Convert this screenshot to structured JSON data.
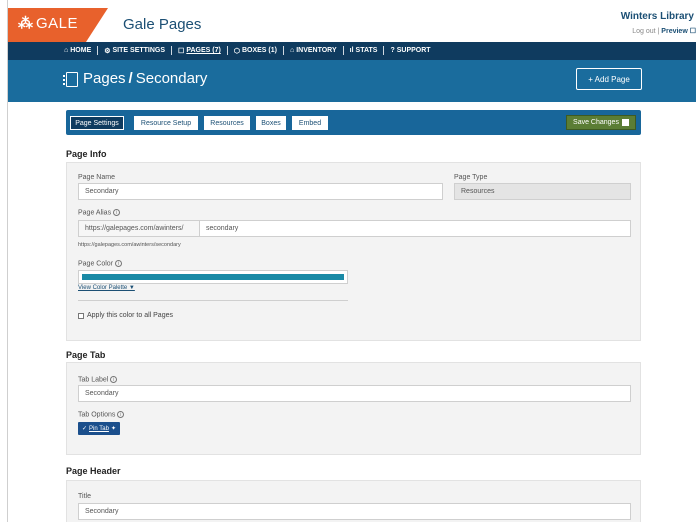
{
  "header": {
    "logo_text": "GALE",
    "app_title": "Gale Pages",
    "library_name": "Winters Library",
    "logout_label": "Log out",
    "preview_label": "Preview"
  },
  "nav": {
    "items": [
      {
        "icon": "home-icon",
        "glyph": "⌂",
        "label": "HOME"
      },
      {
        "icon": "gear-icon",
        "glyph": "⚙",
        "label": "SITE SETTINGS"
      },
      {
        "icon": "pages-icon",
        "glyph": "☐",
        "label": "PAGES (7)"
      },
      {
        "icon": "boxes-icon",
        "glyph": "⬡",
        "label": "BOXES (1)"
      },
      {
        "icon": "inventory-icon",
        "glyph": "⌂",
        "label": "INVENTORY"
      },
      {
        "icon": "stats-icon",
        "glyph": "ıl",
        "label": "STATS"
      },
      {
        "icon": "support-icon",
        "glyph": "?",
        "label": "SUPPORT"
      }
    ],
    "active_index": 2
  },
  "title_band": {
    "section": "Pages",
    "separator": "/",
    "current": "Secondary",
    "add_button": "+ Add Page"
  },
  "tabs": {
    "items": [
      "Page Settings",
      "Resource Setup",
      "Resources",
      "Boxes",
      "Embed"
    ],
    "active_index": 0,
    "save_label": "Save Changes"
  },
  "page_info": {
    "heading": "Page Info",
    "name_label": "Page Name",
    "name_value": "Secondary",
    "type_label": "Page Type",
    "type_value": "Resources",
    "alias_label": "Page Alias",
    "alias_prefix": "https://galepages.com/awinters/",
    "alias_value": "secondary",
    "alias_full_url": "https://galepages.com/awinters/secondary",
    "color_label": "Page Color",
    "color_value": "#1a8aa6",
    "palette_link": "View Color Palette ▼",
    "apply_all_label": "Apply this color to all Pages"
  },
  "page_tab": {
    "heading": "Page Tab",
    "tab_label_label": "Tab Label",
    "tab_label_value": "Secondary",
    "tab_options_label": "Tab Options",
    "pin_button": "Pin Tab"
  },
  "page_header": {
    "heading": "Page Header",
    "title_label": "Title",
    "title_value": "Secondary"
  }
}
